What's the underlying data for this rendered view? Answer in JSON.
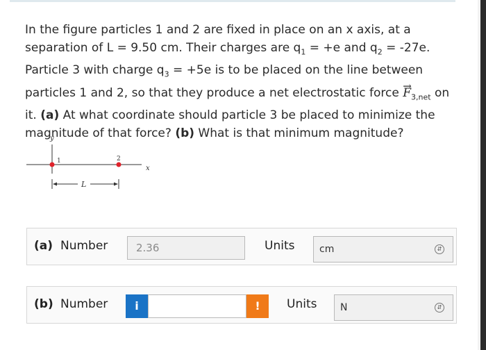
{
  "problem": {
    "text_a": "In the figure particles 1 and 2 are fixed in place on an x axis, at a separation of L = 9.50 cm. Their charges are q",
    "sub1": "1",
    "text_b": " = +e and q",
    "sub2": "2",
    "text_c": " = -27e. Particle 3 with charge q",
    "sub3": "3",
    "text_d": " = +5e is to be placed on the line between particles 1 and 2, so that they produce a net electrostatic force ",
    "force_symbol": "F",
    "force_sub": "3,net",
    "text_e": " on it. ",
    "part_a_tag": "(a)",
    "text_f": " At what coordinate should particle 3 be placed to minimize the magnitude of that force? ",
    "part_b_tag": "(b)",
    "text_g": " What is that minimum magnitude?"
  },
  "figure": {
    "y_axis_label": "y",
    "x_axis_label": "x",
    "particle1_label": "1",
    "particle2_label": "2",
    "separation_label": "L",
    "particle_color": "#e0222b"
  },
  "part_a": {
    "label": "(a)",
    "number_label": "Number",
    "value": "2.36",
    "units_label": "Units",
    "unit_value": "cm"
  },
  "part_b": {
    "label": "(b)",
    "number_label": "Number",
    "info_icon": "i",
    "value": "",
    "warn_icon": "!",
    "units_label": "Units",
    "unit_value": "N"
  },
  "colors": {
    "info": "#1a73c6",
    "warning": "#f07a18"
  }
}
